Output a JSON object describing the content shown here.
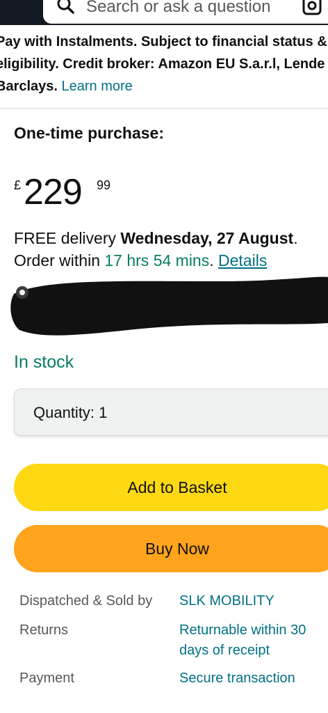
{
  "search": {
    "placeholder": "Search or ask a question"
  },
  "instalments": {
    "line1": "Pay with Instalments. Subject to financial status &",
    "line2": "eligibility. Credit broker: Amazon EU S.a.r.l, Lende",
    "line3": "Barclays.",
    "learn_more": "Learn more"
  },
  "purchase": {
    "title": "One-time purchase:"
  },
  "price": {
    "currency": "£",
    "whole": "229",
    "fraction": "99"
  },
  "delivery": {
    "prefix": "FREE delivery ",
    "date": "Wednesday, 27 August",
    "suffix": ".",
    "order_prefix": "Order within ",
    "countdown": "17 hrs 54 mins",
    "order_suffix": ". ",
    "details": "Details"
  },
  "stock": {
    "status": "In stock"
  },
  "quantity": {
    "label": "Quantity: 1"
  },
  "buttons": {
    "add_to_basket": "Add to Basket",
    "buy_now": "Buy Now"
  },
  "info": {
    "dispatched_label": "Dispatched & Sold by",
    "dispatched_value": "SLK MOBILITY",
    "returns_label": "Returns",
    "returns_value_line1": "Returnable within 30",
    "returns_value_line2": "days of receipt",
    "payment_label": "Payment",
    "payment_value": "Secure transaction"
  },
  "colors": {
    "header": "#131921",
    "link": "#007185",
    "stock_green": "#067d62",
    "add_button": "#ffd814",
    "buy_button": "#ffa41c"
  },
  "icons": [
    "search-icon",
    "camera-icon"
  ]
}
